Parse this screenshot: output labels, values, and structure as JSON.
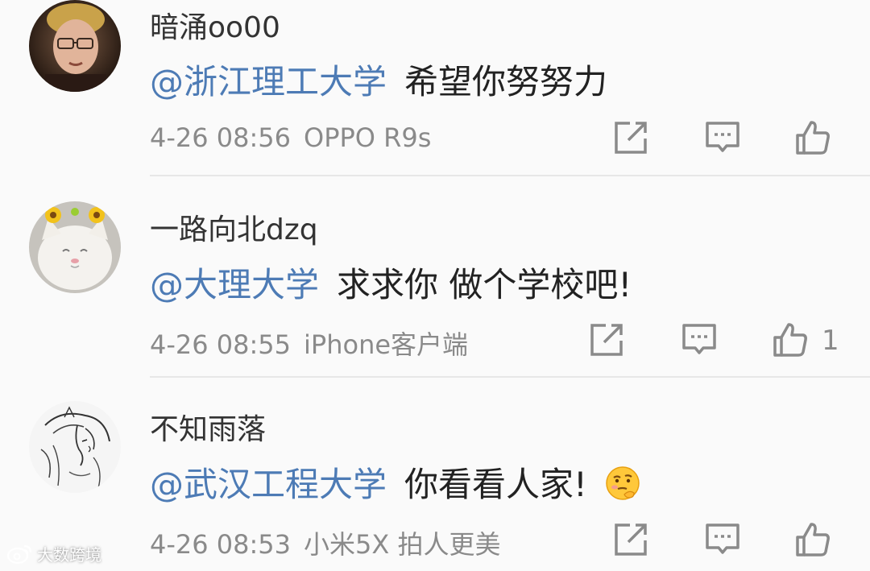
{
  "comments": [
    {
      "username": "暗涌oo00",
      "mention": "@浙江理工大学",
      "text": "希望你努努力",
      "time": "4-26 08:56",
      "source": "OPPO R9s",
      "likes": null
    },
    {
      "username": "一路向北dzq",
      "mention": "@大理大学",
      "text": "求求你 做个学校吧!",
      "time": "4-26 08:55",
      "source": "iPhone客户端",
      "likes": "1"
    },
    {
      "username": "不知雨落",
      "mention": "@武汉工程大学",
      "text": "你看看人家!",
      "time": "4-26 08:53",
      "source": "小米5X 拍人更美",
      "likes": null,
      "emoji": "thinking-face-emoji"
    }
  ],
  "watermark": {
    "text": "大数跨境",
    "icon": "weibo-logo-icon"
  },
  "icons": {
    "repost": "repost-icon",
    "reply": "comment-icon",
    "like": "thumbs-up-icon"
  },
  "colors": {
    "mention": "#4d7bb5",
    "meta": "#8a8a8a",
    "background": "#fafafa",
    "divider": "#e7e7e7"
  }
}
